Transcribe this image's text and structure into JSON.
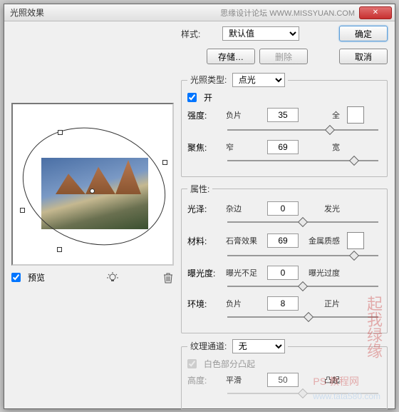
{
  "window": {
    "title": "光照效果",
    "subtitle": "思缘设计论坛  WWW.MISSYUAN.COM",
    "close": "✕"
  },
  "buttons": {
    "ok": "确定",
    "cancel": "取消",
    "save": "存储…",
    "delete": "删除"
  },
  "style": {
    "label": "样式:",
    "value": "默认值"
  },
  "preview": {
    "label": "预览"
  },
  "light_type": {
    "legend": "光照类型:",
    "value": "点光",
    "on_label": "开"
  },
  "intensity": {
    "label": "强度:",
    "left": "负片",
    "value": "35",
    "right": "全",
    "pos": 68
  },
  "focus": {
    "label": "聚焦:",
    "left": "窄",
    "value": "69",
    "right": "宽",
    "pos": 84
  },
  "props": {
    "legend": "属性:"
  },
  "gloss": {
    "label": "光泽:",
    "left": "杂边",
    "value": "0",
    "right": "发光",
    "pos": 50
  },
  "material": {
    "label": "材料:",
    "left": "石膏效果",
    "value": "69",
    "right": "金属质感",
    "pos": 84
  },
  "exposure": {
    "label": "曝光度:",
    "left": "曝光不足",
    "value": "0",
    "right": "曝光过度",
    "pos": 50
  },
  "ambience": {
    "label": "环境:",
    "left": "负片",
    "value": "8",
    "right": "正片",
    "pos": 54
  },
  "texture": {
    "legend": "纹理通道:",
    "value": "无",
    "white_label": "白色部分凸起"
  },
  "height": {
    "label": "高度:",
    "left": "平滑",
    "value": "50",
    "right": "凸起",
    "pos": 50
  },
  "watermarks": {
    "a": "起我绿缘",
    "b": "PS 教程网",
    "c": "www.tata580.com"
  }
}
